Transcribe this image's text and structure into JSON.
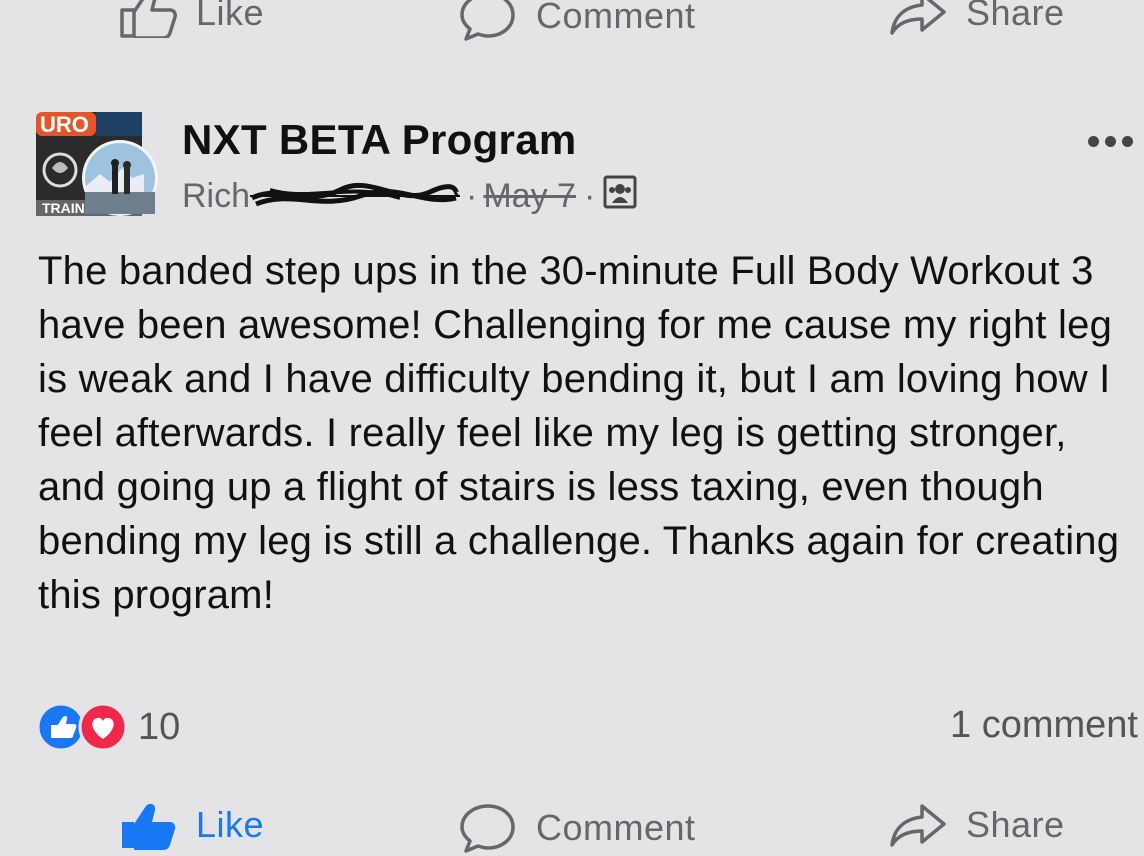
{
  "actions_top": {
    "like_label": "Like",
    "comment_label": "Comment",
    "share_label": "Share"
  },
  "post": {
    "group_name": "NXT BETA Program",
    "author_visible": "Rich",
    "date": "May 7",
    "avatar_text_top": "URO",
    "avatar_text_bottom": "TRAIN",
    "privacy_icon": "group-members-icon",
    "text": "The banded step ups in the 30-minute Full Body Workout 3 have been awesome! Challenging for me cause my right leg is weak and I have difficulty bending it, but I am loving how I feel afterwards. I really feel like my leg is getting stronger, and going up a flight of stairs is less taxing, even though bending my leg is still a challenge. Thanks again for creating this program!",
    "reaction_count": "10",
    "reaction_icons": [
      "like-reaction-icon",
      "love-reaction-icon"
    ],
    "comment_count": "1 comment"
  },
  "actions_bottom": {
    "like_label": "Like",
    "comment_label": "Comment",
    "share_label": "Share"
  },
  "colors": {
    "background": "#e4e4e6",
    "like_blue": "#1877f2",
    "love_red": "#f0284a",
    "secondary_text": "#65676b"
  }
}
